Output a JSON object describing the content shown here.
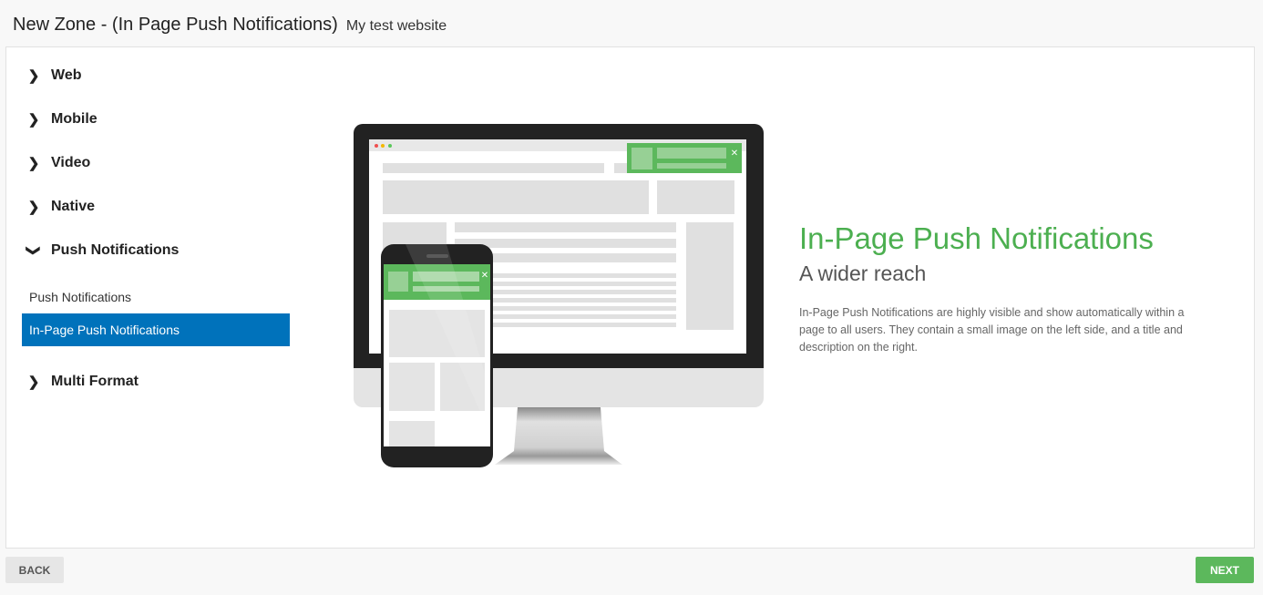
{
  "header": {
    "title": "New Zone - (In Page Push Notifications)",
    "subtitle": "My test website"
  },
  "sidebar": {
    "categories": [
      {
        "label": "Web",
        "expanded": false
      },
      {
        "label": "Mobile",
        "expanded": false
      },
      {
        "label": "Video",
        "expanded": false
      },
      {
        "label": "Native",
        "expanded": false
      },
      {
        "label": "Push Notifications",
        "expanded": true
      },
      {
        "label": "Multi Format",
        "expanded": false
      }
    ],
    "sub_items": [
      {
        "label": "Push Notifications",
        "selected": false
      },
      {
        "label": "In-Page Push Notifications",
        "selected": true
      }
    ],
    "icons": {
      "collapsed": "chevron-right-icon",
      "expanded": "chevron-down-icon"
    }
  },
  "main": {
    "title": "In-Page Push Notifications",
    "subtitle": "A wider reach",
    "description": "In-Page Push Notifications are highly visible and show automatically within a page to all users. They contain a small image on the left side, and a title and description on the right."
  },
  "footer": {
    "back_label": "BACK",
    "next_label": "NEXT"
  },
  "colors": {
    "accent_green": "#5cb85c",
    "selected_blue": "#0072bb",
    "title_green": "#4caf50"
  }
}
